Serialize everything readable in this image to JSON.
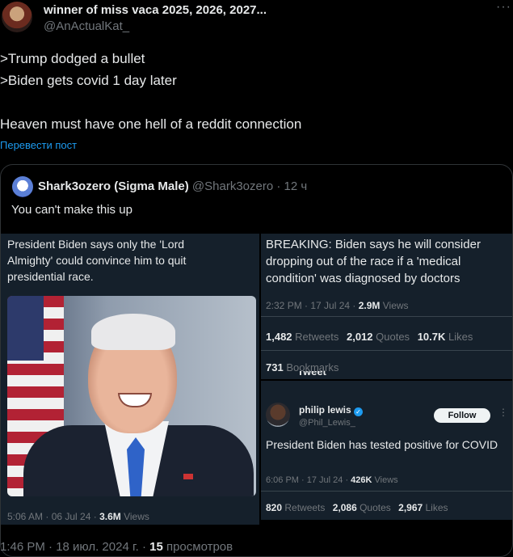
{
  "tweet": {
    "display_name": "winner of miss vaca 2025, 2026, 2027...",
    "handle": "@AnActualKat_",
    "more_icon": "more-dots-icon",
    "lines": [
      ">Trump dodged a bullet",
      ">Biden gets covid 1 day later",
      "Heaven must have one hell of a reddit connection"
    ],
    "translate": "Перевести пост",
    "footer_time": "1:46 PM · 18 июл. 2024 г. · ",
    "footer_views_num": "15",
    "footer_views_label": " просмотров"
  },
  "quote": {
    "display_name": "Shark3ozero (Sigma Male)",
    "handle": "@Shark3ozero",
    "time": "· 12 ч",
    "text": "You can't make this up",
    "left_panel": {
      "headline": "President Biden says only the 'Lord Almighty' could convince him to quit presidential race.",
      "time": "5:06 AM · 06 Jul 24 · ",
      "views_num": "3.6M",
      "views_label": " Views"
    },
    "right_top": {
      "headline": "BREAKING: Biden says he will consider dropping out of the race if a 'medical condition' was diagnosed by doctors",
      "time": "2:32 PM · 17 Jul 24 · ",
      "views_num": "2.9M",
      "views_label": " Views",
      "retweets_num": "1,482",
      "retweets_label": " Retweets",
      "quotes_num": "2,012",
      "quotes_label": " Quotes",
      "likes_num": "10.7K",
      "likes_label": " Likes",
      "bookmarks_num": "731",
      "bookmarks_label": " Bookmarks",
      "cutoff_header": "Tweet"
    },
    "right_bottom": {
      "name": "philip lewis",
      "handle": "@Phil_Lewis_",
      "follow": "Follow",
      "text": "President Biden has tested positive for COVID",
      "time": "6:06 PM · 17 Jul 24 · ",
      "views_num": "426K",
      "views_label": " Views",
      "retweets_num": "820",
      "retweets_label": " Retweets",
      "quotes_num": "2,086",
      "quotes_label": " Quotes",
      "likes_num": "2,967",
      "likes_label": " Likes"
    }
  },
  "colors": {
    "bg": "#000000",
    "muted": "#71767b",
    "link": "#1d9bf0",
    "panel": "#15202b",
    "verified": "#1d9bf0"
  }
}
